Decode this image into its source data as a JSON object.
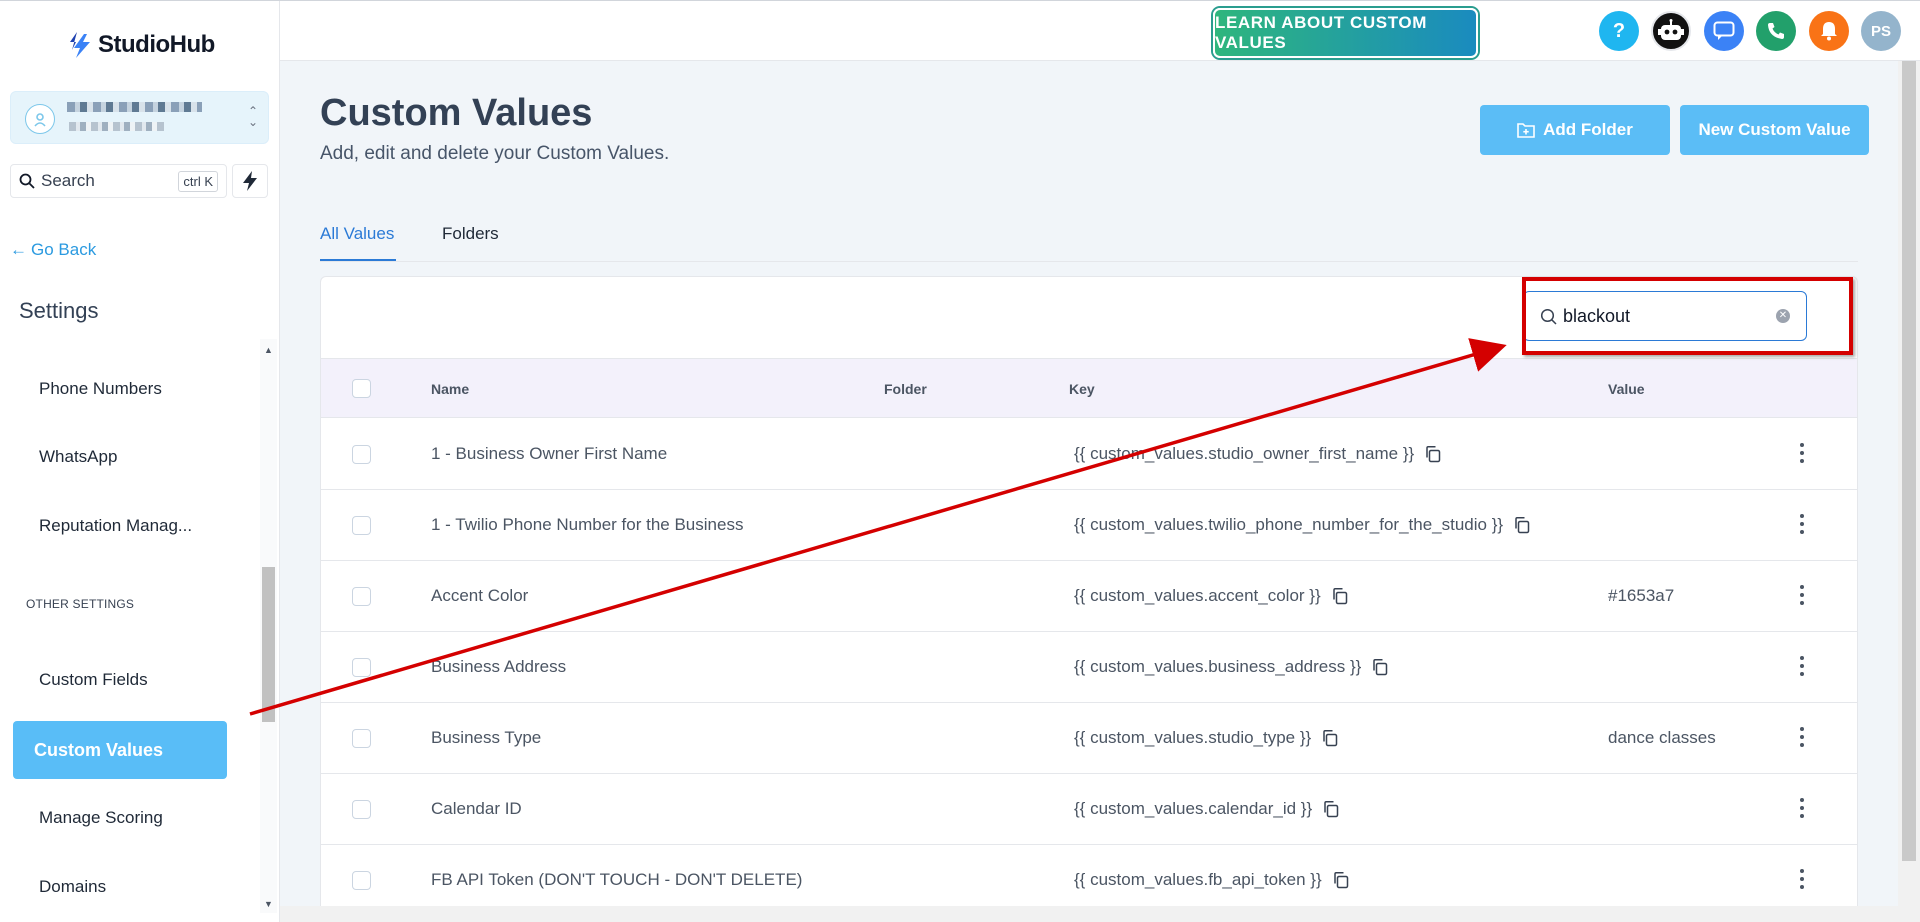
{
  "app": {
    "name": "StudioHub",
    "brand_color": "#3b82f6"
  },
  "sidebar": {
    "search_label": "Search",
    "search_shortcut": "ctrl K",
    "go_back": "Go Back",
    "settings_title": "Settings",
    "items": [
      {
        "label": "Phone Numbers"
      },
      {
        "label": "WhatsApp"
      },
      {
        "label": "Reputation Manag..."
      },
      {
        "label": "Custom Fields"
      },
      {
        "label": "Custom Values"
      },
      {
        "label": "Manage Scoring"
      },
      {
        "label": "Domains"
      }
    ],
    "section_other": "OTHER SETTINGS",
    "active_color": "#59bdf7"
  },
  "header": {
    "learn_button": "LEARN ABOUT CUSTOM VALUES",
    "help_icon": "?",
    "avatar_initials": "PS"
  },
  "page": {
    "title": "Custom Values",
    "subtitle": "Add, edit and delete your Custom Values.",
    "add_folder_button": "Add Folder",
    "new_value_button": "New Custom Value"
  },
  "tabs": [
    {
      "label": "All Values",
      "active": true
    },
    {
      "label": "Folders",
      "active": false
    }
  ],
  "search": {
    "value": "blackout"
  },
  "table": {
    "columns": {
      "name": "Name",
      "folder": "Folder",
      "key": "Key",
      "value": "Value"
    },
    "rows": [
      {
        "name": "1 - Business Owner First Name",
        "key": "{{ custom_values.studio_owner_first_name }}",
        "value": ""
      },
      {
        "name": "1 - Twilio Phone Number for the Business",
        "key": "{{ custom_values.twilio_phone_number_for_the_studio }}",
        "value": ""
      },
      {
        "name": "Accent Color",
        "key": "{{ custom_values.accent_color }}",
        "value": "#1653a7"
      },
      {
        "name": "Business Address",
        "key": "{{ custom_values.business_address }}",
        "value": ""
      },
      {
        "name": "Business Type",
        "key": "{{ custom_values.studio_type }}",
        "value": "dance classes"
      },
      {
        "name": "Calendar ID",
        "key": "{{ custom_values.calendar_id }}",
        "value": ""
      },
      {
        "name": "FB API Token (DON'T TOUCH - DON'T DELETE)",
        "key": "{{ custom_values.fb_api_token }}",
        "value": ""
      }
    ]
  },
  "annotation": {
    "color": "#d40000"
  }
}
